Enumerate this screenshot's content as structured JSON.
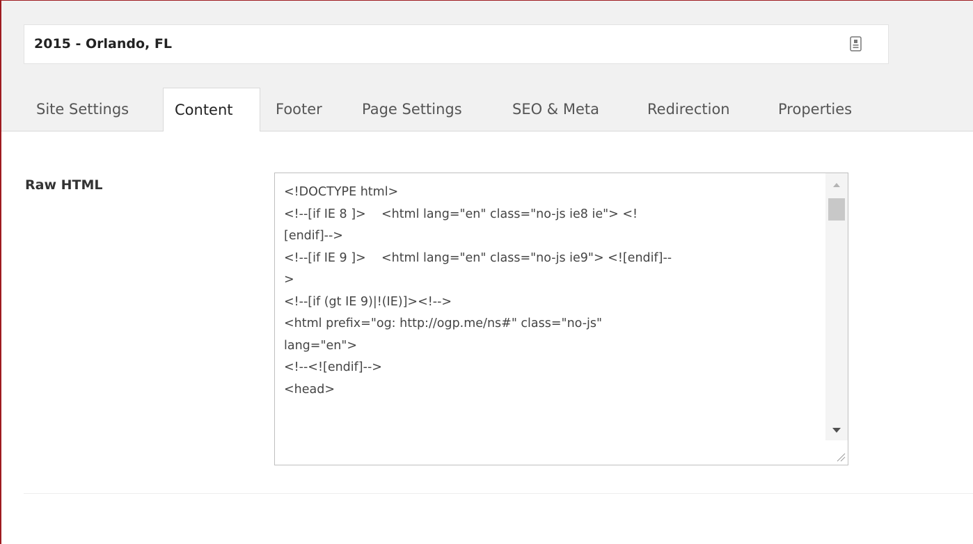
{
  "header": {
    "title": "2015 - Orlando, FL",
    "title_icon": "template-icon"
  },
  "tabs": [
    {
      "label": "Site Settings",
      "active": false
    },
    {
      "label": "Content",
      "active": true
    },
    {
      "label": "Footer",
      "active": false
    },
    {
      "label": "Page Settings",
      "active": false
    },
    {
      "label": "SEO & Meta",
      "active": false
    },
    {
      "label": "Redirection",
      "active": false
    },
    {
      "label": "Properties",
      "active": false
    }
  ],
  "content": {
    "raw_html_label": "Raw HTML",
    "raw_html_value": "<!DOCTYPE html>\n<!--[if IE 8 ]>    <html lang=\"en\" class=\"no-js ie8 ie\"> <!\n[endif]-->\n<!--[if IE 9 ]>    <html lang=\"en\" class=\"no-js ie9\"> <![endif]--\n>\n<!--[if (gt IE 9)|!(IE)]><!-->\n<html prefix=\"og: http://ogp.me/ns#\" class=\"no-js\"\nlang=\"en\">\n<!--<![endif]-->\n<head>"
  },
  "colors": {
    "frame_border": "#9e1b20",
    "top_background": "#f1f1f1"
  }
}
